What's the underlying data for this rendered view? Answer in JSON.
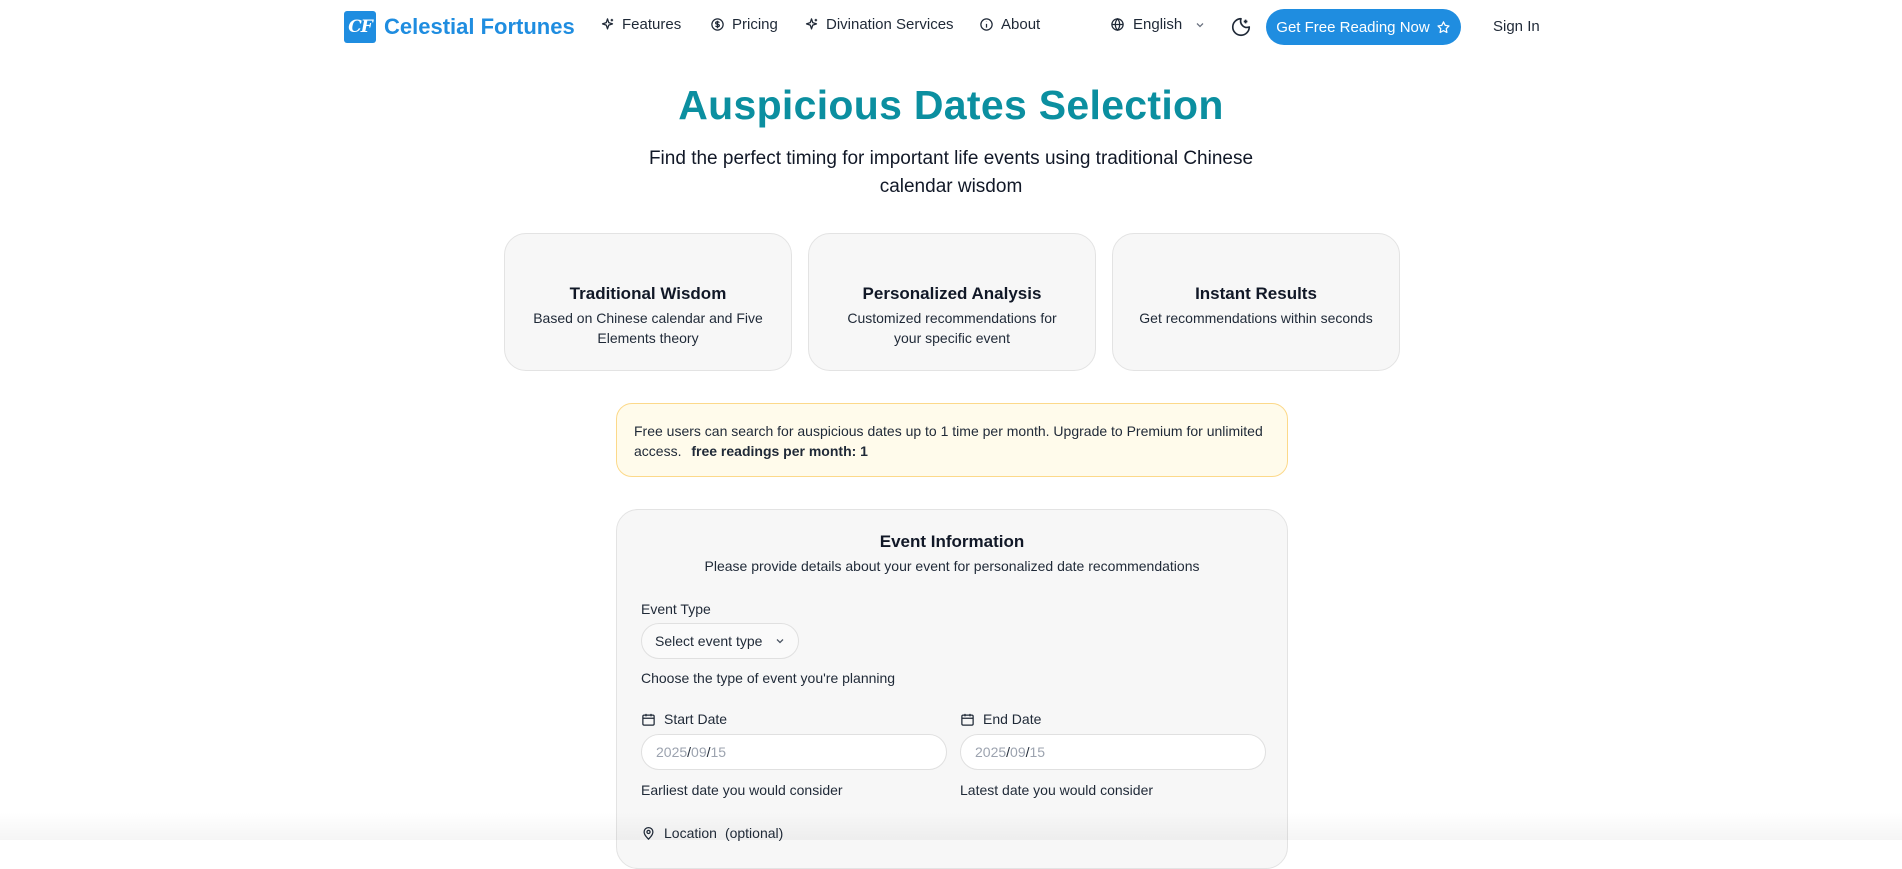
{
  "header": {
    "logo_monogram": "CF",
    "brand": "Celestial Fortunes",
    "nav": [
      {
        "label": "Features",
        "icon": "sparkles-icon"
      },
      {
        "label": "Pricing",
        "icon": "dollar-circle-icon"
      },
      {
        "label": "Divination Services",
        "icon": "sparkles-icon"
      },
      {
        "label": "About",
        "icon": "info-circle-icon"
      }
    ],
    "language": "English",
    "cta_label": "Get Free Reading Now",
    "signin_label": "Sign In"
  },
  "hero": {
    "title": "Auspicious Dates Selection",
    "subtitle": "Find the perfect timing for important life events using traditional Chinese calendar wisdom"
  },
  "features": [
    {
      "title": "Traditional Wisdom",
      "desc": "Based on Chinese calendar and Five Elements theory"
    },
    {
      "title": "Personalized Analysis",
      "desc": "Customized recommendations for your specific event"
    },
    {
      "title": "Instant Results",
      "desc": "Get recommendations within seconds"
    }
  ],
  "notice": {
    "text": "Free users can search for auspicious dates up to 1 time per month. Upgrade to Premium for unlimited access.",
    "strong": "free readings per month: 1"
  },
  "form": {
    "title": "Event Information",
    "desc": "Please provide details about your event for personalized date recommendations",
    "event_type": {
      "label": "Event Type",
      "placeholder": "Select event type",
      "help": "Choose the type of event you're planning"
    },
    "start_date": {
      "label": "Start Date",
      "year": "2025",
      "month": "09",
      "day": "15",
      "help": "Earliest date you would consider"
    },
    "end_date": {
      "label": "End Date",
      "year": "2025",
      "month": "09",
      "day": "15",
      "help": "Latest date you would consider"
    },
    "location": {
      "label": "Location",
      "optional": "(optional)"
    }
  },
  "colors": {
    "brand": "#1f8de0",
    "title": "#0b8fa0",
    "notice_bg": "#fffbeb",
    "notice_border": "#fcd98a"
  }
}
